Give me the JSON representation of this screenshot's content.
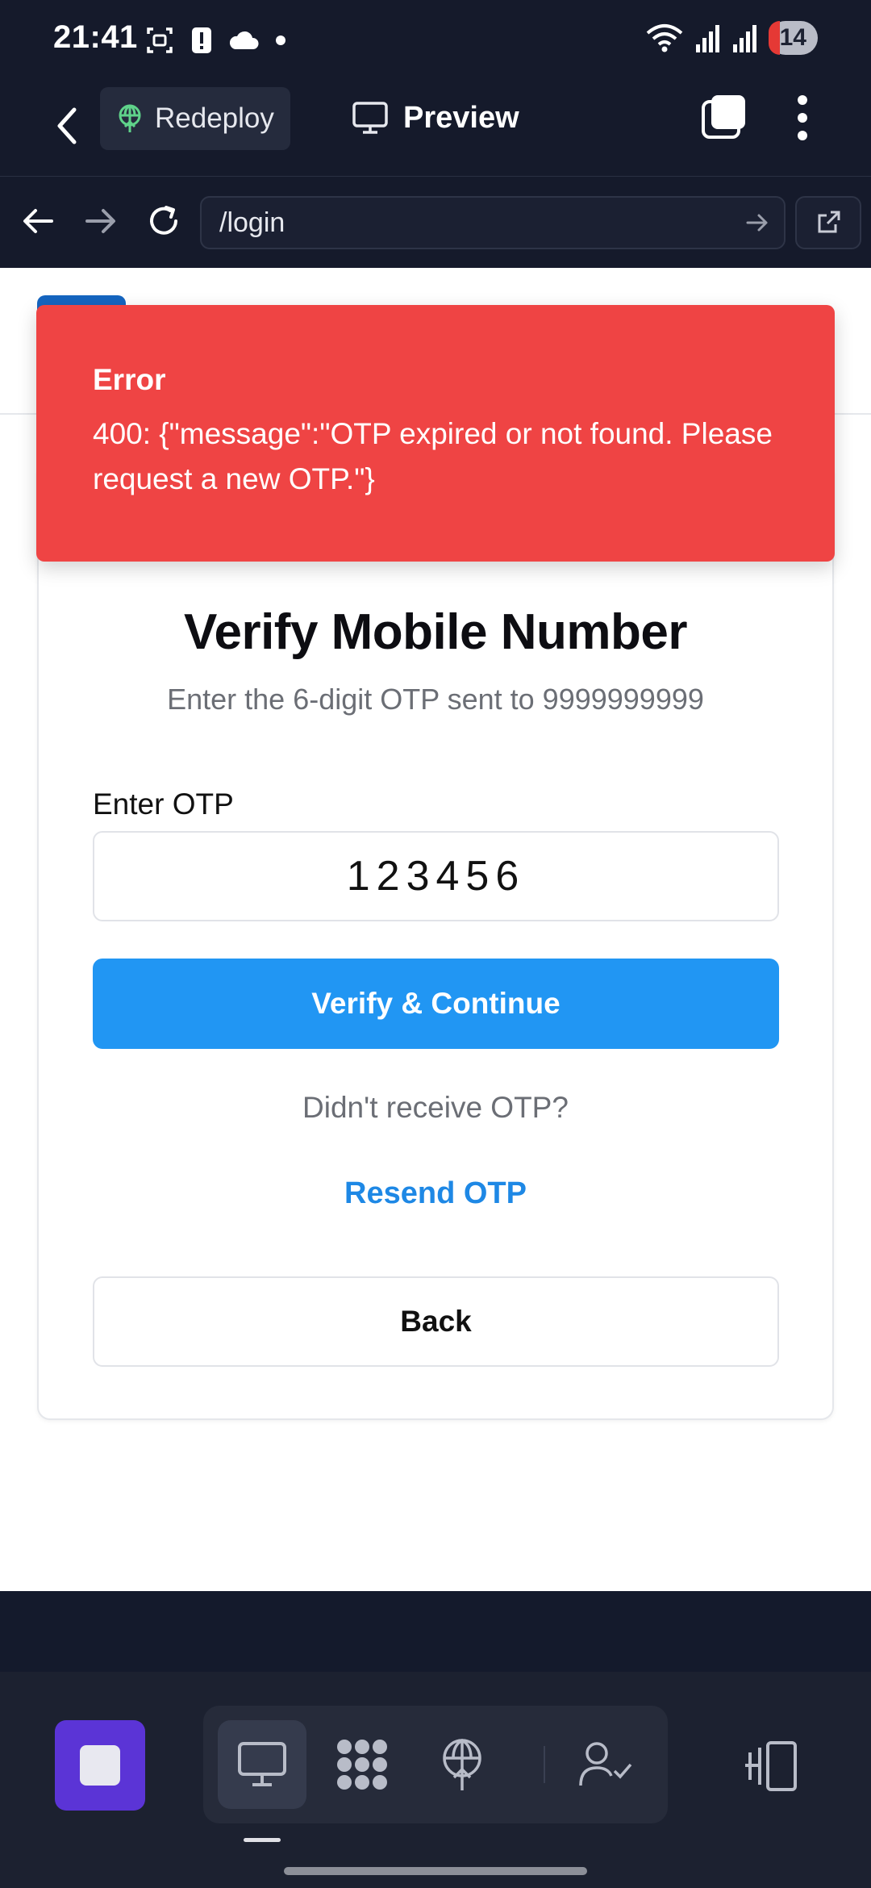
{
  "status_bar": {
    "time": "21:41",
    "battery_level": "14",
    "icons": [
      "screenshot-icon",
      "alert-icon",
      "cloud-icon",
      "dot-icon",
      "wifi-icon",
      "signal-icon",
      "signal-icon"
    ]
  },
  "app_header": {
    "redeploy_label": "Redeploy",
    "preview_label": "Preview"
  },
  "browser": {
    "url": "/login"
  },
  "error_toast": {
    "title": "Error",
    "message": "400: {\"message\":\"OTP expired or not found. Please request a new OTP.\"}"
  },
  "verify_form": {
    "title": "Verify Mobile Number",
    "subtitle": "Enter the 6-digit OTP sent to 9999999999",
    "otp_label": "Enter OTP",
    "otp_value": "123456",
    "verify_button": "Verify & Continue",
    "didnt_receive": "Didn't receive OTP?",
    "resend_link": "Resend OTP",
    "back_button": "Back"
  },
  "dock": {
    "tools": [
      "desktop-icon",
      "apps-icon",
      "deploy-icon",
      "user-check-icon"
    ],
    "active_tool": "desktop-icon"
  },
  "colors": {
    "toast_background": "#ef4444",
    "primary_button": "#2196f3",
    "link": "#1e88e5",
    "stop_button": "#5b34d6",
    "header_background": "#151a2b"
  }
}
